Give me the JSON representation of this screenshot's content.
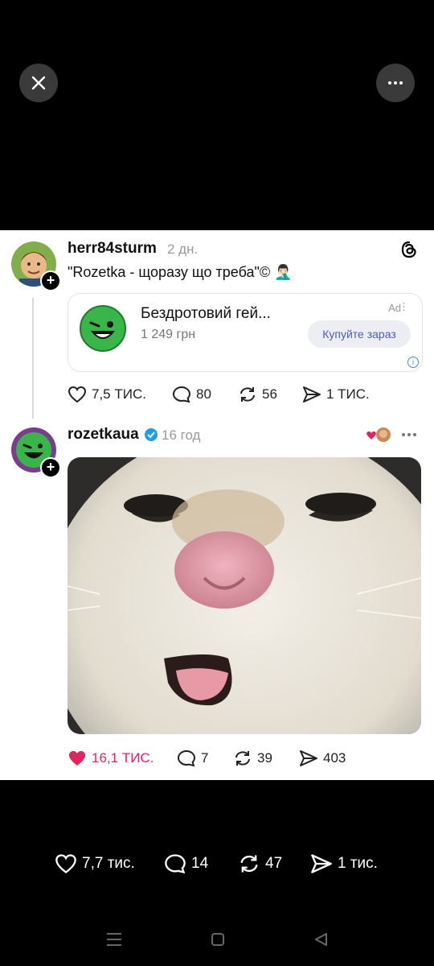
{
  "top_controls": {
    "close_icon": "close-icon",
    "more_icon": "more-horizontal-icon"
  },
  "post1": {
    "username": "herr84sturm",
    "time": "2 дн.",
    "text": "\"Rozetka - щоразу що треба\"© 🤦🏻‍♂️",
    "ad": {
      "title": "Бездротовий гей...",
      "price": "1 249 грн",
      "label": "Ad",
      "cta": "Купуйте зараз"
    },
    "stats": {
      "likes": "7,5 ТИС.",
      "comments": "80",
      "reposts": "56",
      "shares": "1 ТИС."
    }
  },
  "post2": {
    "username": "rozetkaua",
    "time": "16 год",
    "stats": {
      "likes": "16,1 ТИС.",
      "comments": "7",
      "reposts": "39",
      "shares": "403"
    }
  },
  "bottom_bar": {
    "likes": "7,7 тис.",
    "comments": "14",
    "reposts": "47",
    "shares": "1 тис."
  },
  "colors": {
    "liked": "#e0245e",
    "verified": "#1d9bf0",
    "mascot": "#39b54a"
  }
}
